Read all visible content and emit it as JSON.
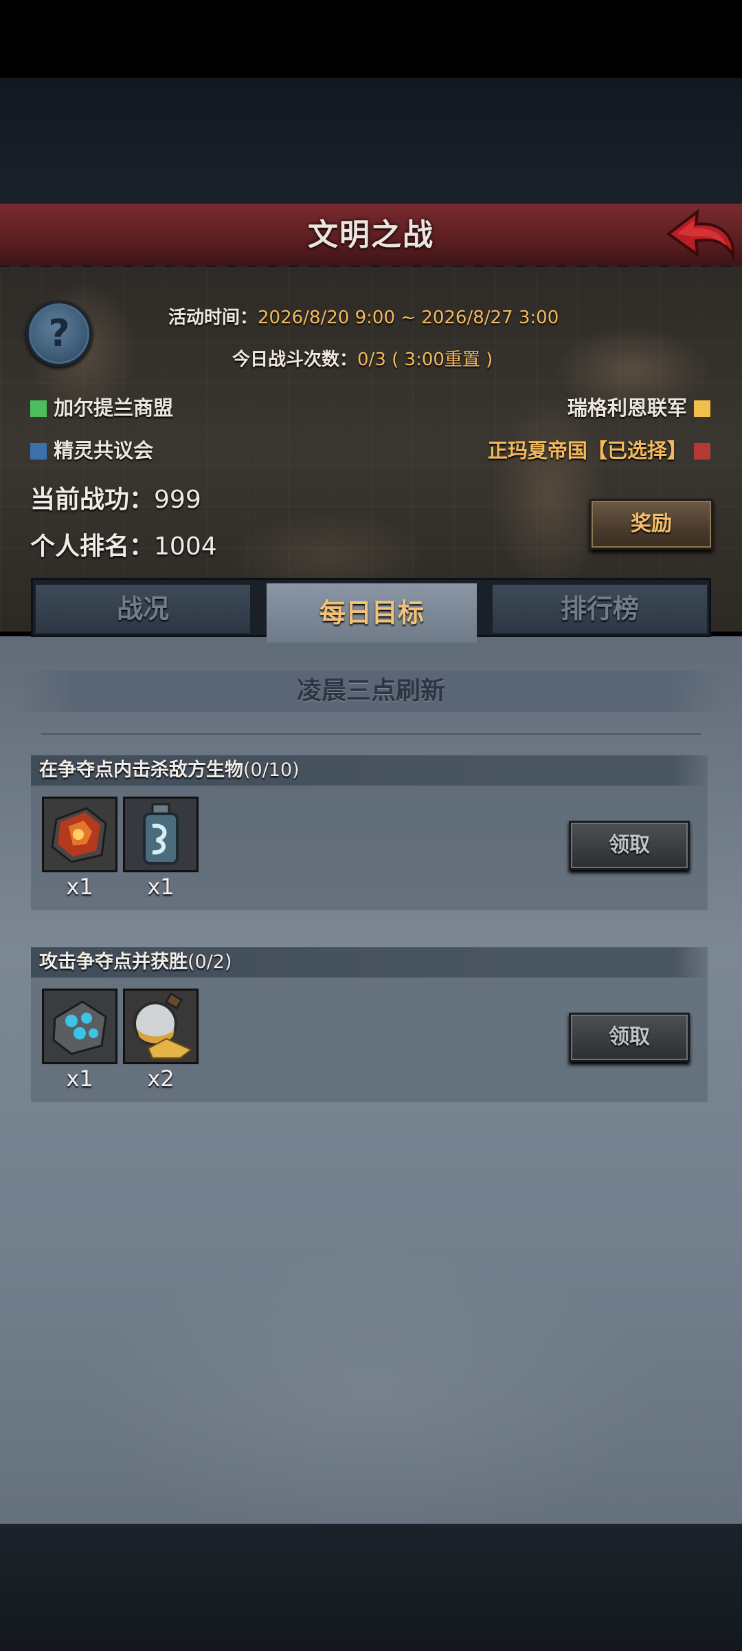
{
  "header": {
    "title": "文明之战"
  },
  "event": {
    "time_label": "活动时间：",
    "time_value": "2026/8/20 9:00 ~ 2026/8/27 3:00",
    "battles_label": "今日战斗次数：",
    "battles_value": "0/3 ( 3:00重置 )"
  },
  "factions": [
    {
      "name": "加尔提兰商盟",
      "color": "#4cbf5c"
    },
    {
      "name": "瑞格利恩联军",
      "color": "#f2c04a"
    },
    {
      "name": "精灵共议会",
      "color": "#3d6fae"
    },
    {
      "name": "正玛夏帝国【已选择】",
      "color": "#b53a35"
    }
  ],
  "stats": {
    "merit_label": "当前战功：",
    "merit_value": "999",
    "rank_label": "个人排名：",
    "rank_value": "1004"
  },
  "reward_button": "奖励",
  "tabs": [
    "战况",
    "每日目标",
    "排行榜"
  ],
  "daily": {
    "refresh_note": "凌晨三点刷新",
    "tasks": [
      {
        "title": "在争夺点内击杀敌方生物",
        "progress": "(0/10)",
        "items": [
          {
            "icon": "lava-ore-icon",
            "qty": "x1"
          },
          {
            "icon": "potion-bottle-icon",
            "qty": "x1"
          }
        ],
        "claim": "领取"
      },
      {
        "title": "攻击争夺点并获胜",
        "progress": "(0/2)",
        "items": [
          {
            "icon": "rune-stone-icon",
            "qty": "x1"
          },
          {
            "icon": "gold-sand-flask-icon",
            "qty": "x2"
          }
        ],
        "claim": "领取"
      }
    ]
  }
}
